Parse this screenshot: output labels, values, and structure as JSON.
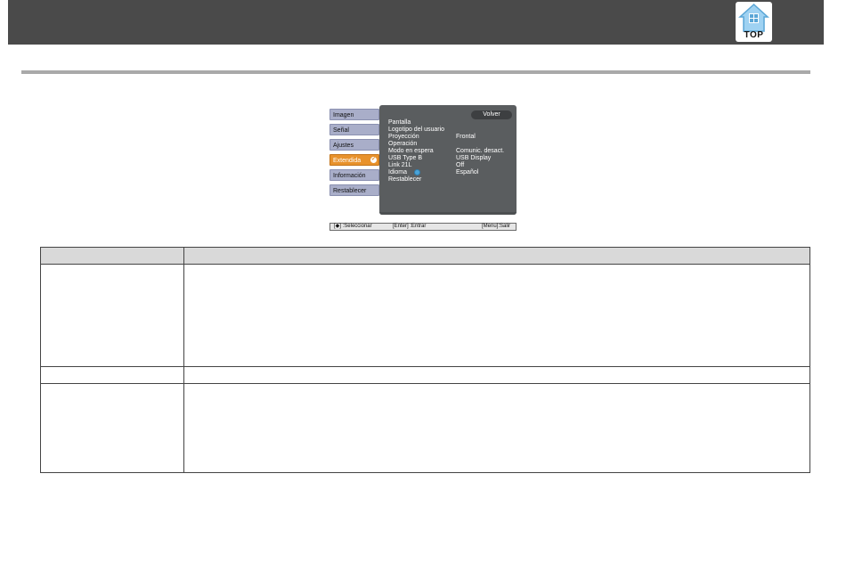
{
  "header": {
    "top_label": "TOP",
    "colors": {
      "bar": "#4a4a4a",
      "divider": "#a9a9a9"
    }
  },
  "osd": {
    "tabs": [
      {
        "label": "Imagen",
        "active": false
      },
      {
        "label": "Señal",
        "active": false
      },
      {
        "label": "Ajustes",
        "active": false
      },
      {
        "label": "Extendida",
        "active": true
      },
      {
        "label": "Información",
        "active": false
      },
      {
        "label": "Restablecer",
        "active": false
      }
    ],
    "back_label": "Volver",
    "items": [
      {
        "label": "Pantalla",
        "value": ""
      },
      {
        "label": "Logotipo del usuario",
        "value": ""
      },
      {
        "label": "Proyección",
        "value": "Frontal"
      },
      {
        "label": "Operación",
        "value": ""
      },
      {
        "label": "Modo en espera",
        "value": "Comunic. desact."
      },
      {
        "label": "USB Type B",
        "value": "USB Display"
      },
      {
        "label": "Link 21L",
        "value": "Off"
      },
      {
        "label": "Idioma",
        "value": "Español",
        "icon": "globe-icon"
      },
      {
        "label": "Restablecer",
        "value": ""
      }
    ],
    "status": {
      "select": "[◆] :Seleccionar",
      "enter": "[Enter] :Entrar",
      "exit": "[Menu]:Salir"
    },
    "colors": {
      "panel": "#5a5d5f",
      "tab": "#a9aec9",
      "active_tab": "#e8922c"
    }
  },
  "table": {
    "rows": [
      {
        "height_class": "header"
      },
      {
        "height_class": "tall"
      },
      {
        "height_class": "short"
      },
      {
        "height_class": "tall"
      }
    ]
  }
}
